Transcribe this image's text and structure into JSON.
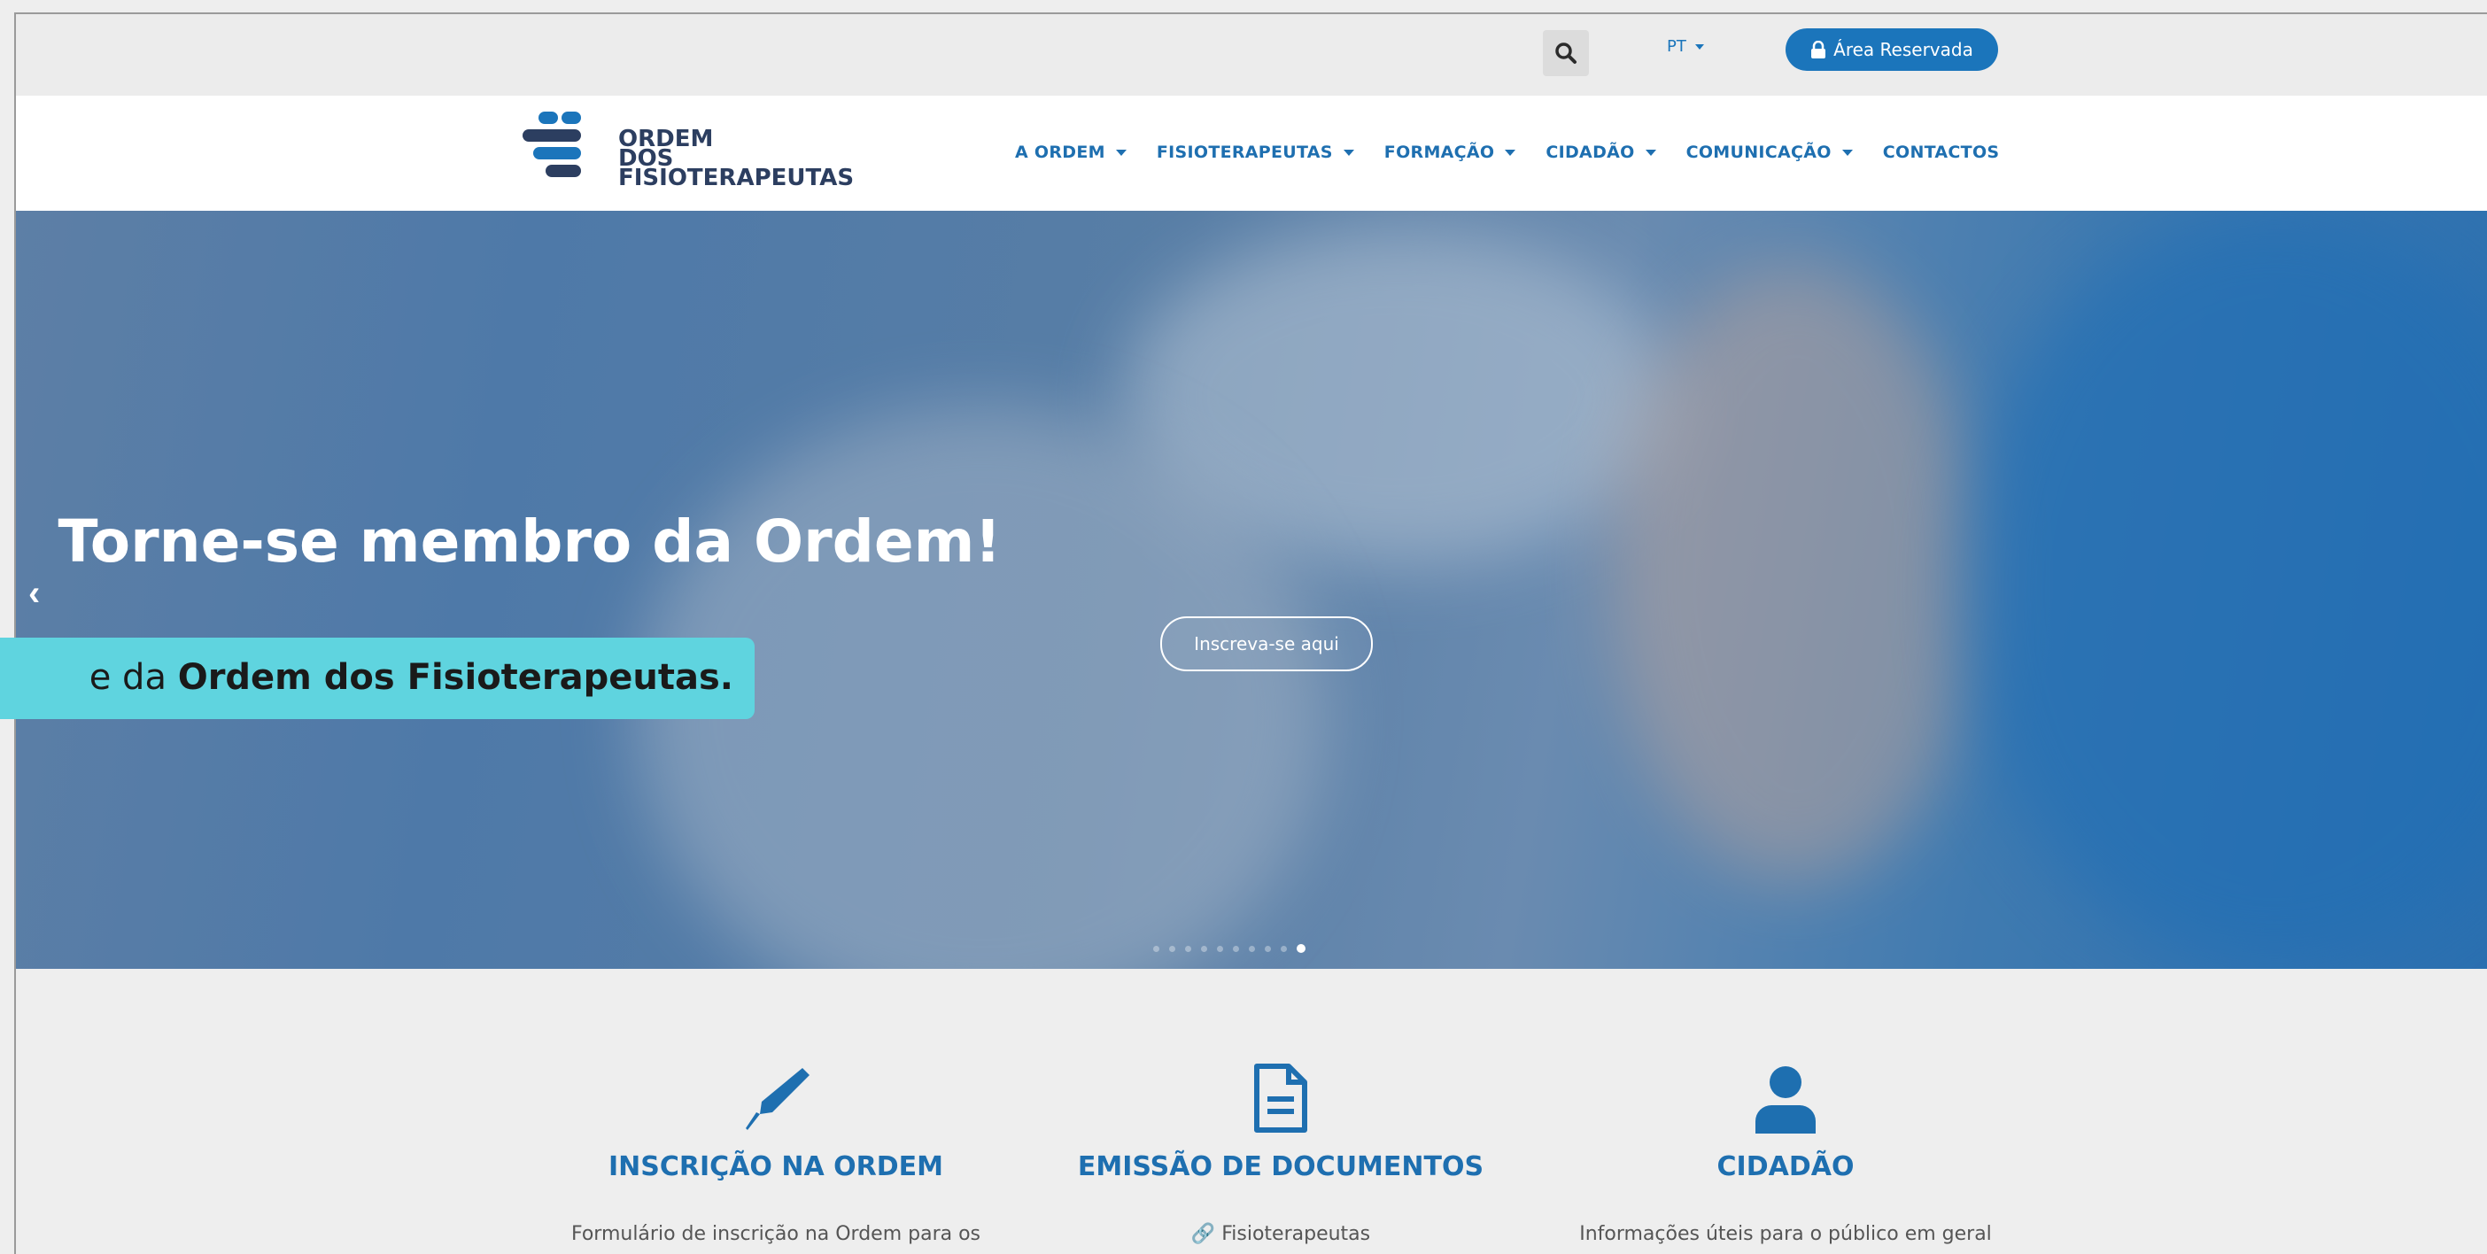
{
  "topbar": {
    "language": "PT",
    "reserved_area_label": "Área Reservada"
  },
  "logo": {
    "line1": "ORDEM",
    "line2": "DOS",
    "line3": "FISIOTERAPEUTAS"
  },
  "nav": {
    "items": [
      {
        "label": "A ORDEM",
        "has_dropdown": true
      },
      {
        "label": "FISIOTERAPEUTAS",
        "has_dropdown": true
      },
      {
        "label": "FORMAÇÃO",
        "has_dropdown": true
      },
      {
        "label": "CIDADÃO",
        "has_dropdown": true
      },
      {
        "label": "COMUNICAÇÃO",
        "has_dropdown": true
      },
      {
        "label": "CONTACTOS",
        "has_dropdown": false
      }
    ]
  },
  "hero": {
    "title": "Torne-se membro da Ordem!",
    "cta_label": "Inscreva-se aqui",
    "slide_count": 10,
    "active_slide": 10
  },
  "caption": {
    "prefix": "e da ",
    "bold": "Ordem dos Fisioterapeutas."
  },
  "features": [
    {
      "icon": "pen-icon",
      "title": "INSCRIÇÃO NA ORDEM",
      "desc": "Formulário de inscrição na Ordem para os"
    },
    {
      "icon": "document-icon",
      "title": "EMISSÃO DE DOCUMENTOS",
      "desc": "🔗 Fisioterapeutas"
    },
    {
      "icon": "user-icon",
      "title": "CIDADÃO",
      "desc": "Informações úteis para o público em geral"
    }
  ],
  "colors": {
    "brand_blue": "#1b75bb",
    "caption_bg": "#5fd4df"
  }
}
